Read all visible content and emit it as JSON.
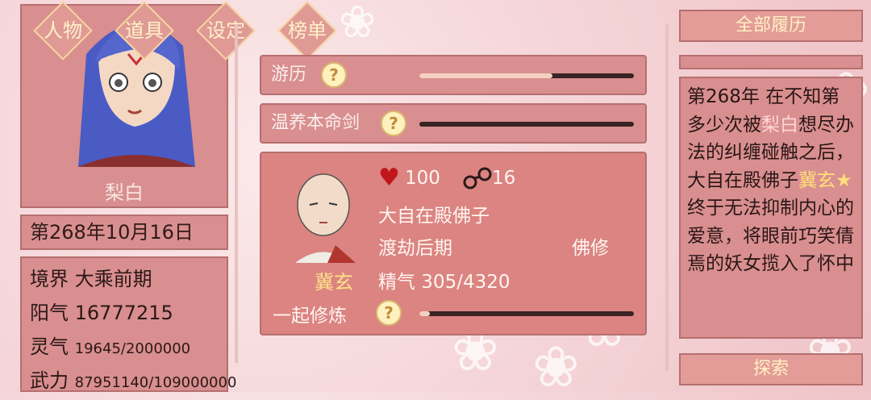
{
  "tabs": [
    "人物",
    "道具",
    "设定",
    "榜单"
  ],
  "character": {
    "name": "梨白",
    "date": "第268年10月16日",
    "stats": [
      {
        "label": "境界",
        "value": "大乘前期"
      },
      {
        "label": "阳气",
        "value": "16777215"
      },
      {
        "label": "灵气",
        "value": "19645/2000000"
      },
      {
        "label": "武力",
        "value": "87951140/109000000"
      }
    ]
  },
  "activities": [
    {
      "label": "游历",
      "progress": 0.62
    },
    {
      "label": "温养本命剑",
      "progress": 0.0
    }
  ],
  "companion": {
    "name": "冀玄",
    "affection": "100",
    "bond": "16",
    "title": "大自在殿佛子",
    "realm": "渡劫后期",
    "path": "佛修",
    "essence": "精气 305/4320",
    "action_label": "一起修炼",
    "action_progress": 0.05
  },
  "log": {
    "header_button": "全部履历",
    "segments": [
      {
        "text": "第268年 在不知第多少次被",
        "style": "normal"
      },
      {
        "text": "梨白",
        "style": "pink"
      },
      {
        "text": "想尽办法的纠缠碰触之后，大自在殿佛子",
        "style": "normal"
      },
      {
        "text": "冀玄★",
        "style": "yellow"
      },
      {
        "text": "终于无法抑制内心的爱意，将眼前巧笑倩焉的妖女揽入了怀中",
        "style": "normal"
      }
    ],
    "explore_button": "探索"
  },
  "colors": {
    "panel": "#d98f8f",
    "panel_border": "#b56f70",
    "button_text": "#fff0c4",
    "highlight_yellow": "#ffe07a",
    "heart": "#c0171c"
  },
  "icons": [
    "question-icon",
    "heart-icon",
    "handcuffs-icon",
    "diamond-tab"
  ]
}
